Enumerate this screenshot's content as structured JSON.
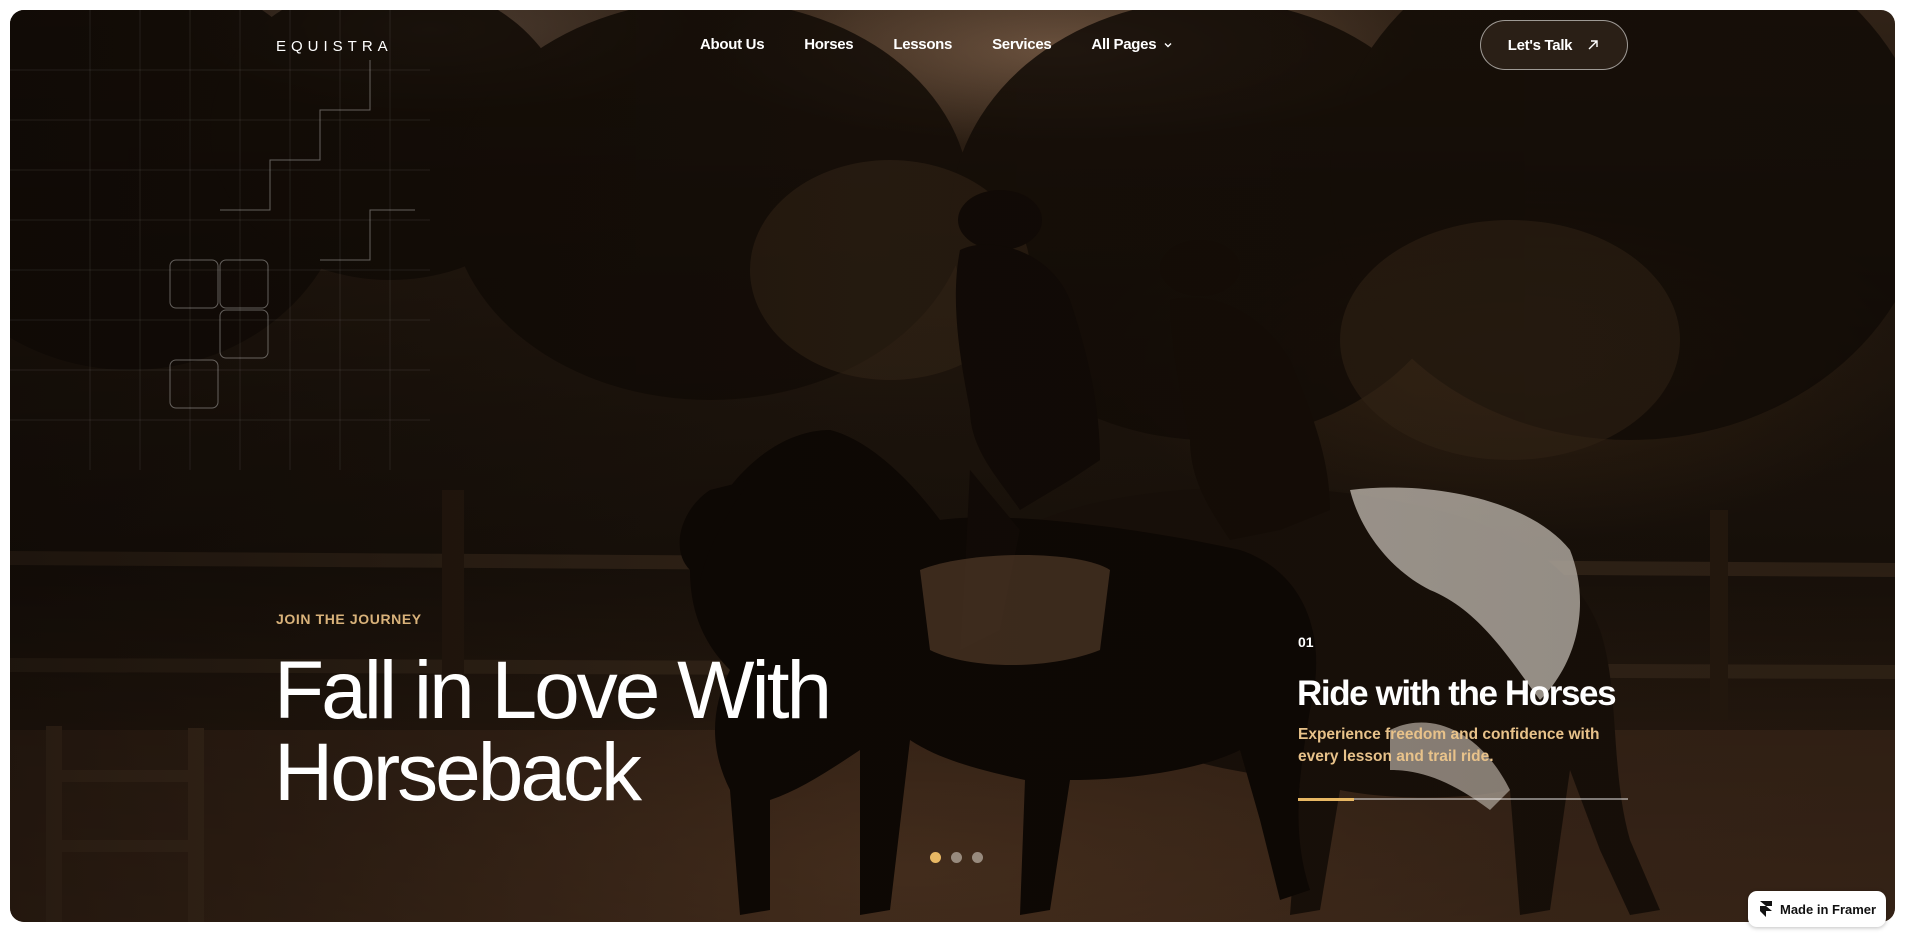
{
  "brand": {
    "logo": "EQUISTRA"
  },
  "nav": {
    "items": [
      "About Us",
      "Horses",
      "Lessons",
      "Services",
      "All Pages"
    ],
    "cta_label": "Let's Talk"
  },
  "hero": {
    "eyebrow": "JOIN THE JOURNEY",
    "headline_line1": "Fall in Love With",
    "headline_line2": "Horseback"
  },
  "slide": {
    "number": "01",
    "title": "Ride with the Horses",
    "description": "Experience freedom and confidence with every lesson and trail ride.",
    "progress": 0.17
  },
  "carousel": {
    "count": 3,
    "active_index": 0
  },
  "badge": {
    "label": "Made in Framer"
  },
  "colors": {
    "accent": "#e8b864",
    "eyebrow": "#d9b27a",
    "desc": "#e8c28a"
  },
  "icons": [
    "arrow-up-right-icon",
    "chevron-down-icon",
    "framer-logo-icon"
  ]
}
